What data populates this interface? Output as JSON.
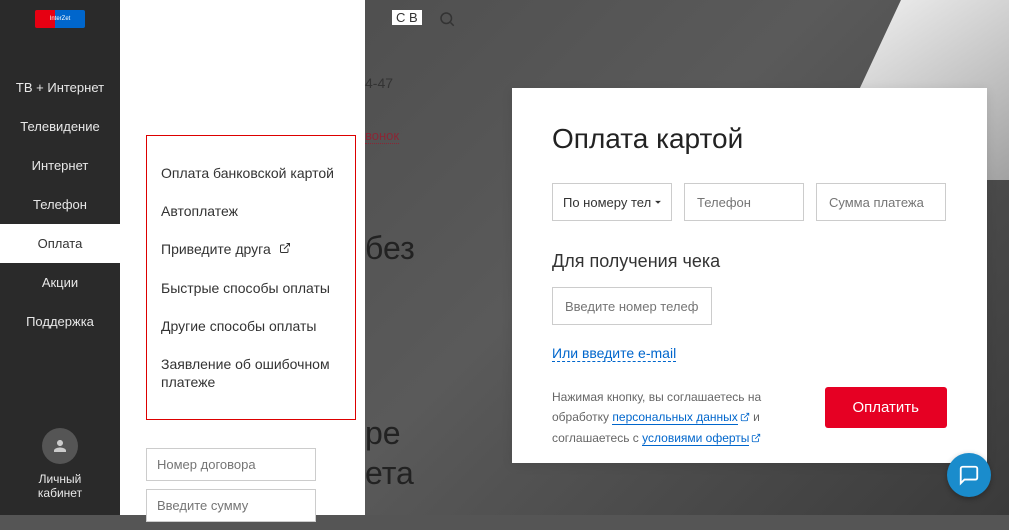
{
  "sidebar": {
    "logo_text": "InterZet",
    "items": [
      {
        "label": "ТВ + Интернет"
      },
      {
        "label": "Телевидение"
      },
      {
        "label": "Интернет"
      },
      {
        "label": "Телефон"
      },
      {
        "label": "Оплата"
      },
      {
        "label": "Акции"
      },
      {
        "label": "Поддержка"
      }
    ],
    "account_label": "Личный кабинет"
  },
  "submenu": {
    "items": [
      {
        "label": "Оплата банковской картой"
      },
      {
        "label": "Автоплатеж"
      },
      {
        "label": "Приведите друга",
        "external": true
      },
      {
        "label": "Быстрые способы оплаты"
      },
      {
        "label": "Другие способы оплаты"
      },
      {
        "label": "Заявление об ошибочном платеже"
      }
    ],
    "contract_placeholder": "Номер договора",
    "amount_placeholder": "Введите сумму"
  },
  "fragments": {
    "top_right": "С В",
    "phone_frag": "4-47",
    "callback": "вонок",
    "without": "без",
    "bottom1": "ре",
    "bottom2": "ета"
  },
  "payment": {
    "title": "Оплата картой",
    "select_label": "По номеру тел",
    "phone_placeholder": "Телефон",
    "amount_placeholder": "Сумма платежа",
    "check_title": "Для получения чека",
    "check_placeholder": "Введите номер телефо",
    "email_link": "Или введите e-mail",
    "agreement_text1": "Нажимая кнопку, вы соглашаетесь на обработку ",
    "agreement_link1": "персональных данных",
    "agreement_text2": " и соглашаетесь с ",
    "agreement_link2": "условиями оферты",
    "pay_button": "Оплатить"
  }
}
